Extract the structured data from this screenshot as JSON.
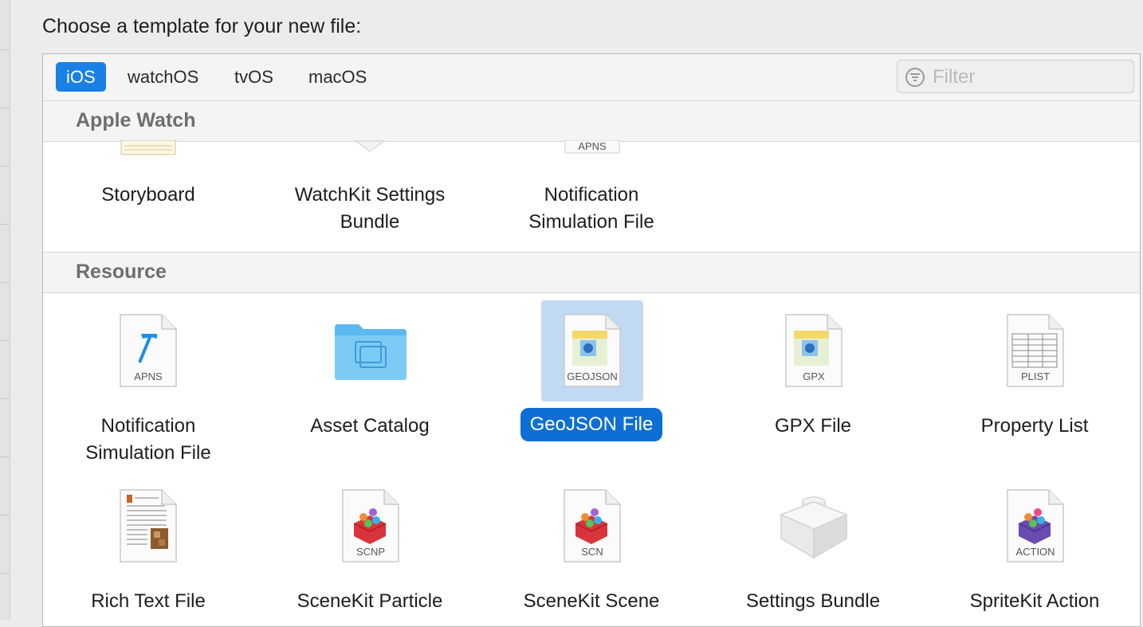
{
  "prompt": "Choose a template for your new file:",
  "tabs": [
    {
      "label": "iOS",
      "active": true
    },
    {
      "label": "watchOS",
      "active": false
    },
    {
      "label": "tvOS",
      "active": false
    },
    {
      "label": "macOS",
      "active": false
    }
  ],
  "filter": {
    "placeholder": "Filter",
    "value": ""
  },
  "sections": [
    {
      "title": "Apple Watch",
      "items": [
        {
          "label": "Storyboard",
          "icon": "storyboard-icon"
        },
        {
          "label": "WatchKit Settings Bundle",
          "icon": "watchkit-settings-icon"
        },
        {
          "label": "Notification Simulation File",
          "icon": "apns-file-icon",
          "icon_text": "APNS"
        }
      ]
    },
    {
      "title": "Resource",
      "items": [
        {
          "label": "Notification Simulation File",
          "icon": "apns-file-icon",
          "icon_text": "APNS"
        },
        {
          "label": "Asset Catalog",
          "icon": "folder-icon"
        },
        {
          "label": "GeoJSON File",
          "icon": "geojson-file-icon",
          "icon_text": "GEOJSON",
          "selected": true
        },
        {
          "label": "GPX File",
          "icon": "gpx-file-icon",
          "icon_text": "GPX"
        },
        {
          "label": "Property List",
          "icon": "plist-file-icon",
          "icon_text": "PLIST"
        },
        {
          "label": "Rich Text File",
          "icon": "rich-text-file-icon"
        },
        {
          "label": "SceneKit Particle",
          "icon": "scnp-file-icon",
          "icon_text": "SCNP"
        },
        {
          "label": "SceneKit Scene",
          "icon": "scn-file-icon",
          "icon_text": "SCN"
        },
        {
          "label": "Settings Bundle",
          "icon": "settings-bundle-icon"
        },
        {
          "label": "SpriteKit Action",
          "icon": "spritekit-action-icon",
          "icon_text": "ACTION"
        }
      ]
    }
  ],
  "colors": {
    "accent": "#1a80e6",
    "selection": "#0d6fd6",
    "icon_selection": "#c1d9f3"
  }
}
